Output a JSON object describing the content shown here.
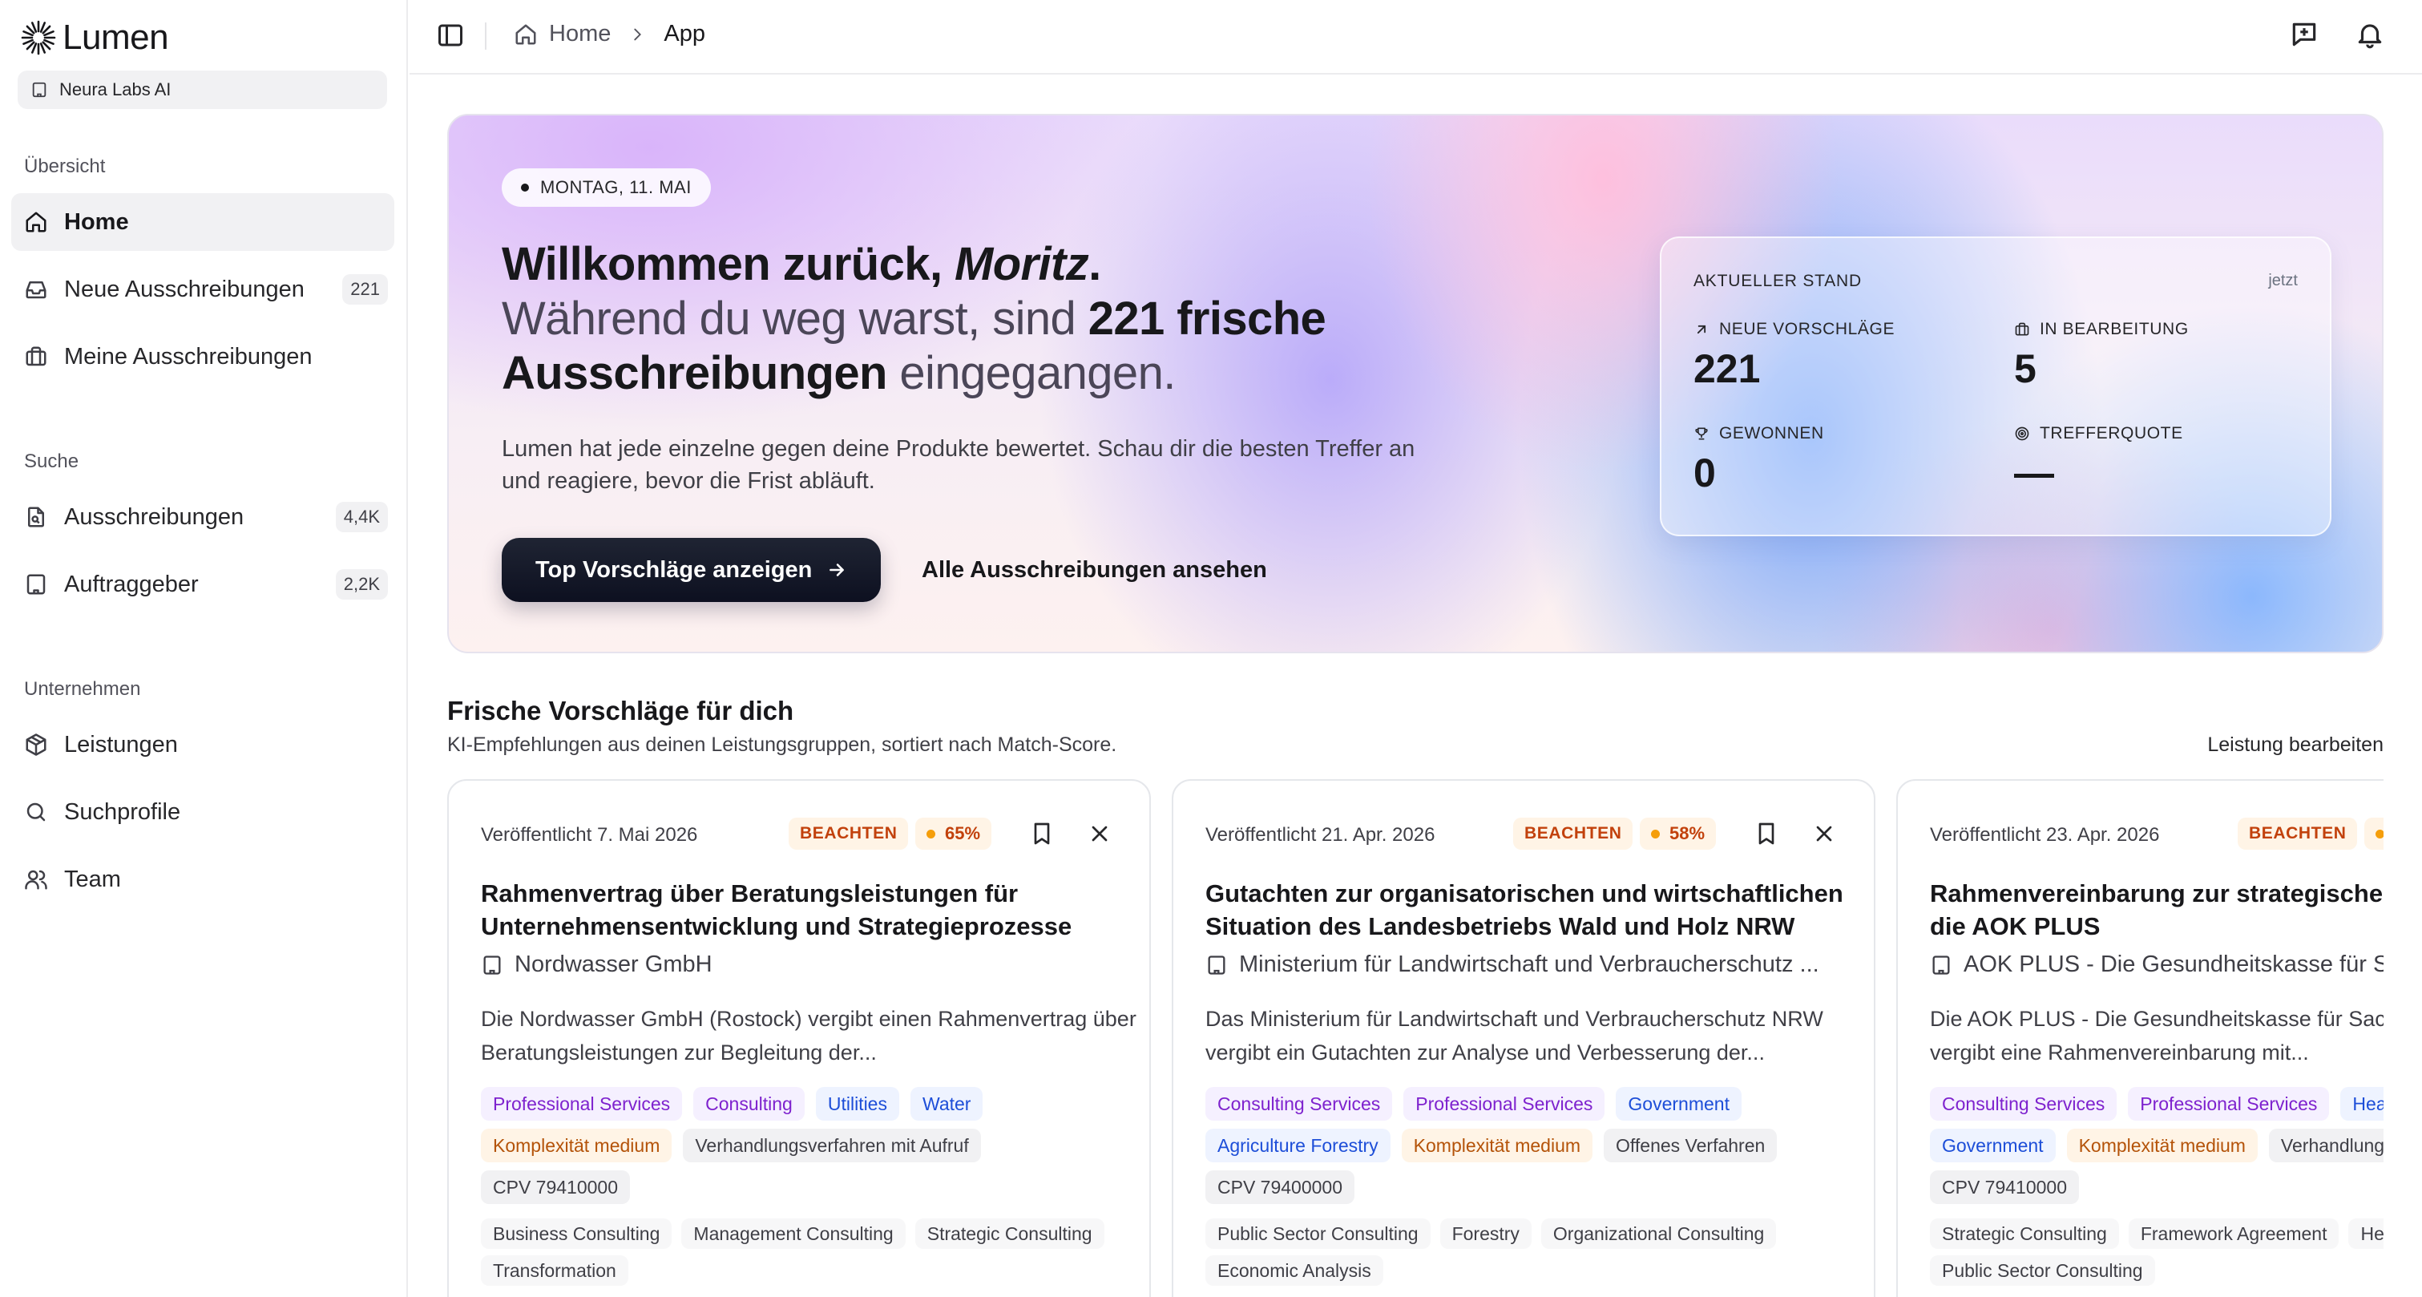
{
  "brand": {
    "name": "Lumen"
  },
  "org": {
    "name": "Neura Labs AI"
  },
  "sidebar": {
    "sections": [
      {
        "label": "Übersicht"
      },
      {
        "label": "Suche"
      },
      {
        "label": "Unternehmen"
      }
    ],
    "items": [
      {
        "label": "Home",
        "count": ""
      },
      {
        "label": "Neue Ausschreibungen",
        "count": "221"
      },
      {
        "label": "Meine Ausschreibungen",
        "count": ""
      },
      {
        "label": "Ausschreibungen",
        "count": "4,4K"
      },
      {
        "label": "Auftraggeber",
        "count": "2,2K"
      },
      {
        "label": "Leistungen",
        "count": ""
      },
      {
        "label": "Suchprofile",
        "count": ""
      },
      {
        "label": "Team",
        "count": ""
      }
    ]
  },
  "header": {
    "breadcrumb": [
      "Home",
      "App"
    ]
  },
  "hero": {
    "date": "MONTAG, 11. MAI",
    "greeting_prefix": "Willkommen zurück, ",
    "user_name": "Moritz",
    "greeting_suffix": ".",
    "line2_prefix": "Während du weg warst, sind ",
    "line2_bold": "221 frische Ausschreibungen",
    "line2_suffix": " eingegangen.",
    "description": "Lumen hat jede einzelne gegen deine Produkte bewertet. Schau dir die besten Treffer an und reagiere, bevor die Frist abläuft.",
    "primary_button": "Top Vorschläge anzeigen",
    "secondary_button": "Alle Ausschreibungen ansehen"
  },
  "stats": {
    "title": "AKTUELLER STAND",
    "updated": "jetzt",
    "items": [
      {
        "label": "NEUE VORSCHLÄGE",
        "value": "221",
        "icon": "arrow-up-right-icon"
      },
      {
        "label": "IN BEARBEITUNG",
        "value": "5",
        "icon": "briefcase-icon"
      },
      {
        "label": "GEWONNEN",
        "value": "0",
        "icon": "trophy-icon"
      },
      {
        "label": "TREFFERQUOTE",
        "value": "—",
        "icon": "target-icon"
      }
    ]
  },
  "suggestions": {
    "title": "Frische Vorschläge für dich",
    "subtitle": "KI-Empfehlungen aus deinen Leistungsgruppen, sortiert nach Match-Score.",
    "edit_link": "Leistung bearbeiten",
    "cards": [
      {
        "date": "Veröffentlicht 7. Mai 2026",
        "status": "BEACHTEN",
        "score": "65%",
        "title": "Rahmenvertrag über Beratungsleistungen für Unternehmensentwicklung und Strategieprozesse",
        "org": "Nordwasser GmbH",
        "description": "Die Nordwasser GmbH (Rostock) vergibt einen Rahmenvertrag über Beratungsleistungen zur Begleitung der...",
        "tags": [
          {
            "label": "Professional Services",
            "color": "purple"
          },
          {
            "label": "Consulting",
            "color": "purple"
          },
          {
            "label": "Utilities",
            "color": "blue"
          },
          {
            "label": "Water",
            "color": "blue"
          },
          {
            "label": "Komplexität medium",
            "color": "orange"
          },
          {
            "label": "Verhandlungsverfahren mit Aufruf",
            "color": "gray"
          },
          {
            "label": "CPV 79410000",
            "color": "gray"
          }
        ],
        "keywords": [
          "Business Consulting",
          "Management Consulting",
          "Strategic Consulting",
          "Transformation"
        ]
      },
      {
        "date": "Veröffentlicht 21. Apr. 2026",
        "status": "BEACHTEN",
        "score": "58%",
        "title": "Gutachten zur organisatorischen und wirtschaftlichen Situation des Landesbetriebs Wald und Holz NRW",
        "org": "Ministerium für Landwirtschaft und Verbraucherschutz ...",
        "description": "Das Ministerium für Landwirtschaft und Verbraucherschutz NRW vergibt ein Gutachten zur Analyse und Verbesserung der...",
        "tags": [
          {
            "label": "Consulting Services",
            "color": "purple"
          },
          {
            "label": "Professional Services",
            "color": "purple"
          },
          {
            "label": "Government",
            "color": "blue"
          },
          {
            "label": "Agriculture Forestry",
            "color": "blue"
          },
          {
            "label": "Komplexität medium",
            "color": "orange"
          },
          {
            "label": "Offenes Verfahren",
            "color": "gray"
          },
          {
            "label": "CPV 79400000",
            "color": "gray"
          }
        ],
        "keywords": [
          "Public Sector Consulting",
          "Forestry",
          "Organizational Consulting",
          "Economic Analysis"
        ]
      },
      {
        "date": "Veröffentlicht 23. Apr. 2026",
        "status": "BEACHTEN",
        "score": "",
        "title": "Rahmenvereinbarung zur strategischen Beratung für die AOK PLUS",
        "org": "AOK PLUS - Die Gesundheitskasse für Sachsen und Thüringen",
        "description": "Die AOK PLUS - Die Gesundheitskasse für Sachsen und Thüringen vergibt eine Rahmenvereinbarung mit...",
        "tags": [
          {
            "label": "Consulting Services",
            "color": "purple"
          },
          {
            "label": "Professional Services",
            "color": "purple"
          },
          {
            "label": "Healthcare",
            "color": "blue"
          },
          {
            "label": "Government",
            "color": "blue"
          },
          {
            "label": "Komplexität medium",
            "color": "orange"
          },
          {
            "label": "Verhandlungsverfahren mit Aufruf",
            "color": "gray"
          },
          {
            "label": "CPV 79410000",
            "color": "gray"
          }
        ],
        "keywords": [
          "Strategic Consulting",
          "Framework Agreement",
          "Healthcare",
          "Public Sector Consulting"
        ]
      }
    ]
  }
}
